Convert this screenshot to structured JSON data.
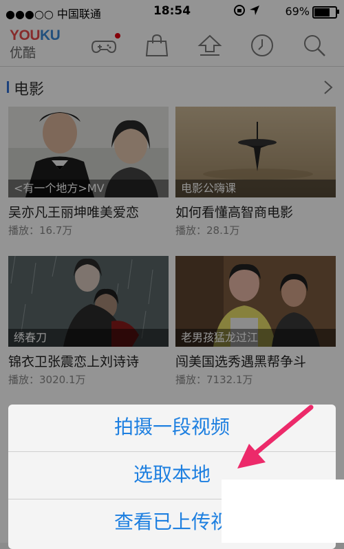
{
  "status_bar": {
    "carrier": "●●●○○ 中国联通",
    "time": "18:54",
    "battery_pct": "69%",
    "battery_level": 0.69
  },
  "header": {
    "logo_en_a": "YOU",
    "logo_en_b": "KU",
    "logo_zh": "优酷",
    "icons": [
      "game-controller-icon",
      "shopping-bag-icon",
      "upload-icon",
      "history-clock-icon",
      "search-icon"
    ]
  },
  "section": {
    "title": "电影"
  },
  "videos": [
    {
      "caption": "<有一个地方>MV",
      "title": "吴亦凡王丽坤唯美爱恋",
      "plays": "播放：16.7万"
    },
    {
      "caption": "电影公嗨课",
      "title": "如何看懂高智商电影",
      "plays": "播放：28.1万"
    },
    {
      "caption": "绣春刀",
      "title": "锦衣卫张震恋上刘诗诗",
      "plays": "播放：3020.1万"
    },
    {
      "caption": "老男孩猛龙过江",
      "title": "闯美国选秀遇黑帮争斗",
      "plays": "播放：7132.1万"
    }
  ],
  "action_sheet": {
    "options": [
      "拍摄一段视频",
      "选取本地",
      "查看已上传视"
    ]
  },
  "colors": {
    "accent_blue": "#1d7fe0",
    "annotation_arrow": "#ec2a6a",
    "logo_red": "#e94a4a",
    "logo_blue": "#3a8bd8"
  }
}
